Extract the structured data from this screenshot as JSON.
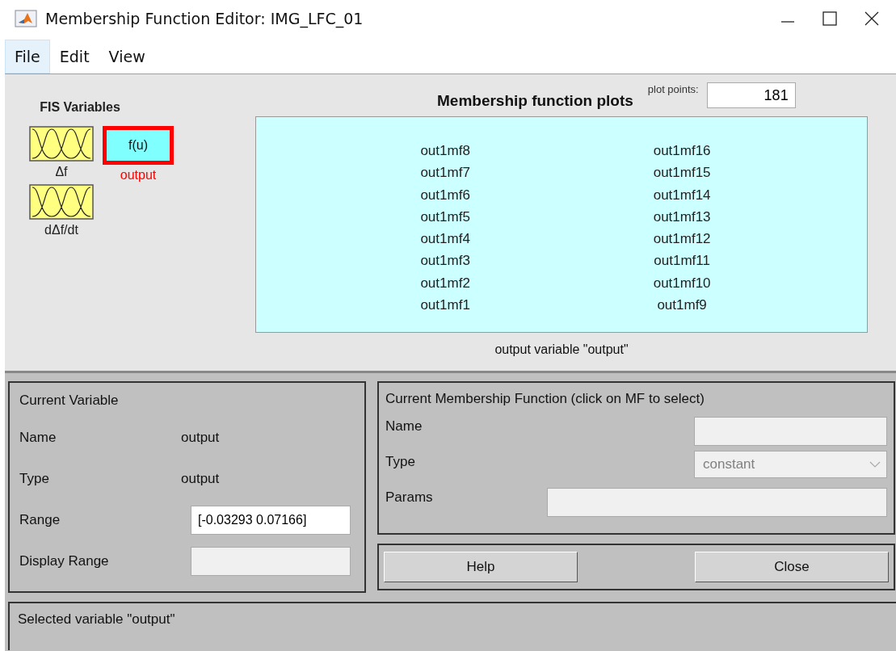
{
  "window": {
    "title": "Membership Function Editor: IMG_LFC_01"
  },
  "menu": [
    {
      "label": "File",
      "selected": true
    },
    {
      "label": "Edit",
      "selected": false
    },
    {
      "label": "View",
      "selected": false
    }
  ],
  "fis_variables": {
    "title": "FIS Variables",
    "items": [
      {
        "kind": "input",
        "label": "Δf",
        "selected": false
      },
      {
        "kind": "output",
        "label": "output",
        "symbol": "f(u)",
        "selected": true
      },
      {
        "kind": "input",
        "label": "dΔf/dt",
        "selected": false
      }
    ]
  },
  "plot": {
    "title": "Membership function plots",
    "plot_points_label": "plot points:",
    "plot_points": "181",
    "columns": [
      [
        "out1mf8",
        "out1mf7",
        "out1mf6",
        "out1mf5",
        "out1mf4",
        "out1mf3",
        "out1mf2",
        "out1mf1"
      ],
      [
        "out1mf16",
        "out1mf15",
        "out1mf14",
        "out1mf13",
        "out1mf12",
        "out1mf11",
        "out1mf10",
        "out1mf9"
      ]
    ],
    "caption": "output variable \"output\""
  },
  "current_variable": {
    "title": "Current Variable",
    "rows": [
      {
        "kind": "text",
        "label": "Name",
        "value": "output"
      },
      {
        "kind": "text",
        "label": "Type",
        "value": "output"
      },
      {
        "kind": "field",
        "label": "Range",
        "value": "[-0.03293 0.07166]",
        "disabled": false
      },
      {
        "kind": "field",
        "label": "Display Range",
        "disabled": true
      }
    ]
  },
  "current_mf": {
    "title": "Current Membership Function (click on MF to select)",
    "rows": [
      {
        "kind": "field",
        "label": "Name",
        "disabled": true
      },
      {
        "kind": "dropdown",
        "label": "Type",
        "value": "constant",
        "disabled": true
      },
      {
        "kind": "wide_field",
        "label": "Params",
        "disabled": true
      }
    ]
  },
  "buttons": [
    "Help",
    "Close"
  ],
  "status_bar": "Selected variable \"output\""
}
